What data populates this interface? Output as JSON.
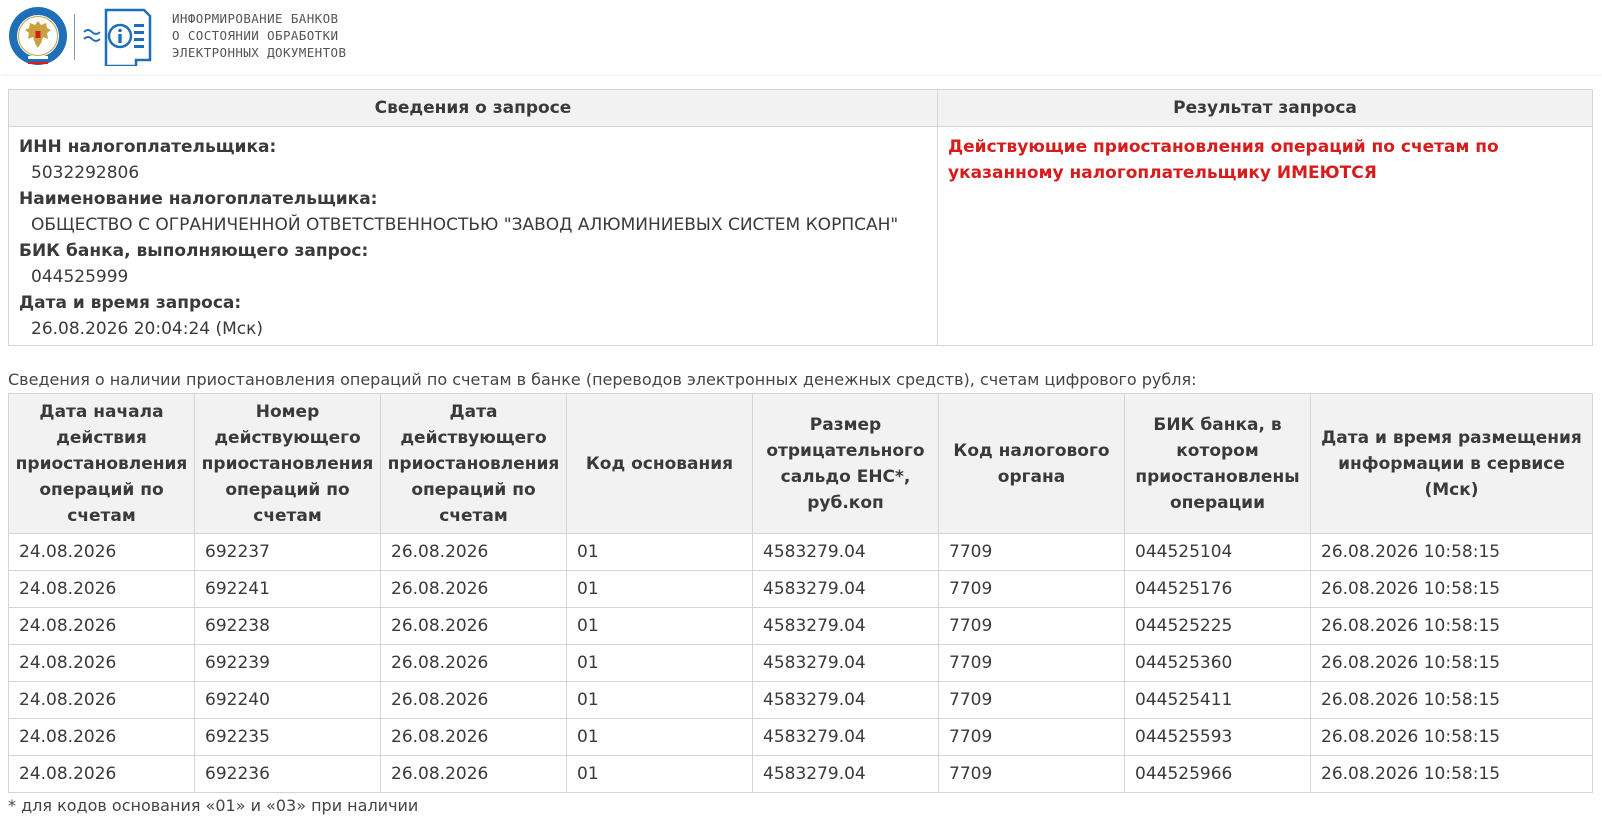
{
  "header": {
    "title_lines": [
      "ИНФОРМИРОВАНИЕ БАНКОВ",
      "О СОСТОЯНИИ ОБРАБОТКИ",
      "ЭЛЕКТРОННЫХ ДОКУМЕНТОВ"
    ],
    "emblem_icon": "fns-emblem-icon",
    "service_icon": "info-document-icon",
    "colors": {
      "brand_blue": "#1e6fb8",
      "emblem_gold": "#c8a23c"
    }
  },
  "request": {
    "info_header": "Сведения о запросе",
    "result_header": "Результат запроса",
    "fields": [
      {
        "label": "ИНН налогоплательщика:",
        "value": "5032292806"
      },
      {
        "label": "Наименование налогоплательщика:",
        "value": "ОБЩЕСТВО С ОГРАНИЧЕННОЙ ОТВЕТСТВЕННОСТЬЮ \"ЗАВОД АЛЮМИНИЕВЫХ СИСТЕМ КОРПСАН\""
      },
      {
        "label": "БИК банка, выполняющего запрос:",
        "value": "044525999"
      },
      {
        "label": "Дата и время запроса:",
        "value": "26.08.2026 20:04:24 (Мск)"
      }
    ],
    "result_text": "Действующие приостановления операций по счетам по указанному налогоплательщику ИМЕЮТСЯ",
    "result_color": "#d81c1c"
  },
  "suspensions": {
    "caption": "Сведения о наличии приостановления операций по счетам в банке (переводов электронных денежных средств), счетам цифрового рубля:",
    "columns": [
      "Дата начала действия приостановления операций по счетам",
      "Номер действующего приостановления операций по счетам",
      "Дата действующего приостановления операций по счетам",
      "Код основания",
      "Размер отрицательного сальдо ЕНС*, руб.коп",
      "Код налогового органа",
      "БИК банка, в котором приостановлены операции",
      "Дата и время размещения информации в сервисе (Мск)"
    ],
    "rows": [
      [
        "24.08.2026",
        "692237",
        "26.08.2026",
        "01",
        "4583279.04",
        "7709",
        "044525104",
        "26.08.2026 10:58:15"
      ],
      [
        "24.08.2026",
        "692241",
        "26.08.2026",
        "01",
        "4583279.04",
        "7709",
        "044525176",
        "26.08.2026 10:58:15"
      ],
      [
        "24.08.2026",
        "692238",
        "26.08.2026",
        "01",
        "4583279.04",
        "7709",
        "044525225",
        "26.08.2026 10:58:15"
      ],
      [
        "24.08.2026",
        "692239",
        "26.08.2026",
        "01",
        "4583279.04",
        "7709",
        "044525360",
        "26.08.2026 10:58:15"
      ],
      [
        "24.08.2026",
        "692240",
        "26.08.2026",
        "01",
        "4583279.04",
        "7709",
        "044525411",
        "26.08.2026 10:58:15"
      ],
      [
        "24.08.2026",
        "692235",
        "26.08.2026",
        "01",
        "4583279.04",
        "7709",
        "044525593",
        "26.08.2026 10:58:15"
      ],
      [
        "24.08.2026",
        "692236",
        "26.08.2026",
        "01",
        "4583279.04",
        "7709",
        "044525966",
        "26.08.2026 10:58:15"
      ]
    ],
    "footnote": "* для кодов основания «01» и «03» при наличии"
  }
}
